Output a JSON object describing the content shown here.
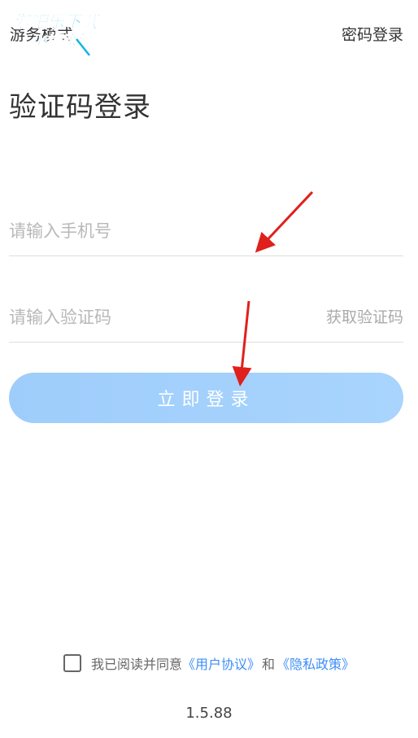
{
  "header": {
    "guest_mode_label": "游务模式",
    "watermark_line1": "游吧乐下载",
    "watermark_line2": "小编亲测",
    "password_login_label": "密码登录"
  },
  "title": "验证码登录",
  "form": {
    "phone_placeholder": "请输入手机号",
    "code_placeholder": "请输入验证码",
    "get_code_label": "获取验证码",
    "login_button_label": "立即登录"
  },
  "agreement": {
    "prefix": "我已阅读并同意",
    "user_agreement": "《用户协议》",
    "and": "和",
    "privacy_policy": "《隐私政策》",
    "checked": false
  },
  "version": "1.5.88",
  "colors": {
    "accent": "#3e8ef7",
    "button": "#a8d4fd",
    "annotation_arrow": "#e0201c"
  }
}
